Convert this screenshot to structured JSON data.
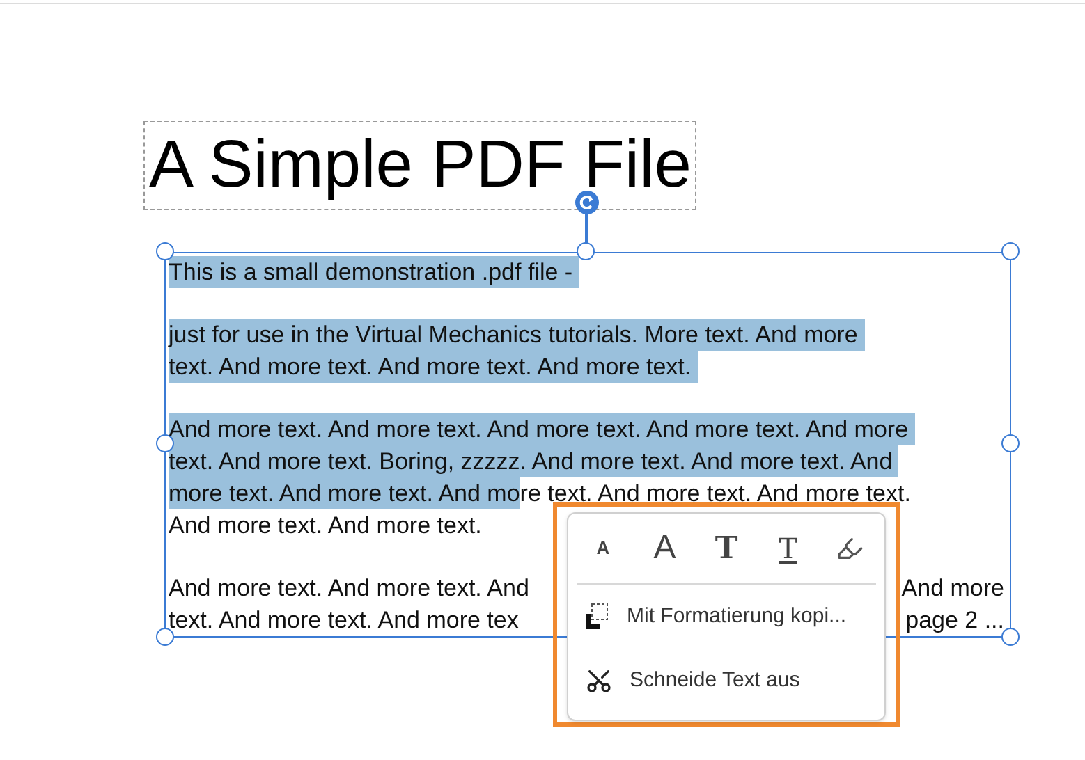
{
  "title": "A Simple PDF File",
  "body": [
    {
      "segments": [
        {
          "text": "This is a small demonstration .pdf file - ",
          "selected": true
        }
      ]
    },
    {
      "kind": "gap"
    },
    {
      "segments": [
        {
          "text": "just for use in the Virtual Mechanics tutorials. More text. And more ",
          "selected": true
        }
      ]
    },
    {
      "segments": [
        {
          "text": "text. And more text. And more text. And more text. ",
          "selected": true
        }
      ]
    },
    {
      "kind": "gap"
    },
    {
      "segments": [
        {
          "text": "And more text. And more text. And more text. And more text. And more ",
          "selected": true
        }
      ]
    },
    {
      "segments": [
        {
          "text": "text. And more text. Boring, zzzzz. And more text. And more text. And ",
          "selected": true
        }
      ]
    },
    {
      "segments": [
        {
          "text": "more text. And more text. And mo",
          "selected": true
        },
        {
          "text": "re text. And more text. And more text.",
          "selected": false
        }
      ]
    },
    {
      "segments": [
        {
          "text": "And more text. And more text.",
          "selected": false
        }
      ]
    },
    {
      "kind": "gap"
    },
    {
      "segments": [
        {
          "text": "And more text. And more text. And",
          "selected": false
        },
        {
          "text": "And more",
          "selected": false,
          "trailing": true
        }
      ]
    },
    {
      "segments": [
        {
          "text": "text. And more text. And more tex",
          "selected": false
        },
        {
          "text": "page 2 ...",
          "selected": false,
          "trailing": true
        }
      ]
    }
  ],
  "menu": {
    "tools": [
      {
        "kind": "small",
        "label": "A"
      },
      {
        "kind": "large",
        "label": "A"
      },
      {
        "kind": "bold",
        "label": "T"
      },
      {
        "kind": "underline",
        "label": "T"
      },
      {
        "kind": "highlighter"
      }
    ],
    "items": [
      {
        "kind": "copy-format",
        "label": "Mit Formatierung kopi..."
      },
      {
        "kind": "cut",
        "label": "Schneide Text aus"
      }
    ]
  }
}
